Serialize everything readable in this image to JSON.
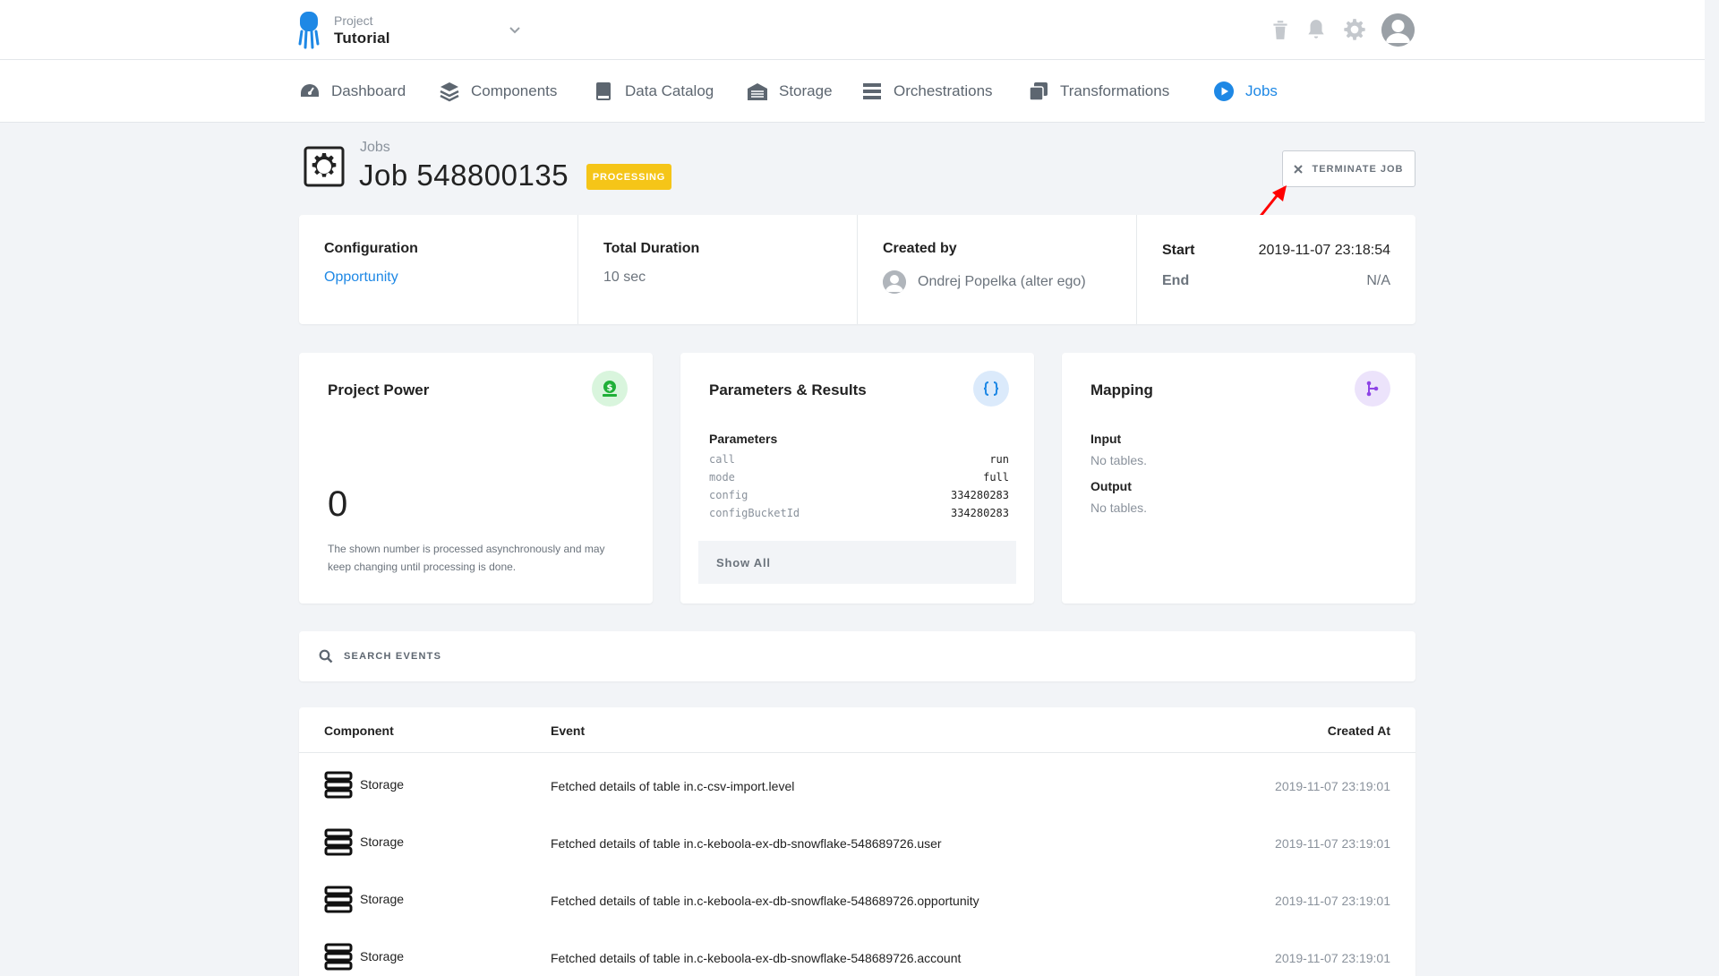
{
  "project": {
    "label": "Project",
    "name": "Tutorial"
  },
  "nav": [
    {
      "label": "Dashboard",
      "icon": "gauge-icon"
    },
    {
      "label": "Components",
      "icon": "layers-icon"
    },
    {
      "label": "Data Catalog",
      "icon": "book-icon"
    },
    {
      "label": "Storage",
      "icon": "warehouse-icon"
    },
    {
      "label": "Orchestrations",
      "icon": "bars-icon"
    },
    {
      "label": "Transformations",
      "icon": "copy-icon"
    },
    {
      "label": "Jobs",
      "icon": "play-circle-icon"
    }
  ],
  "header": {
    "breadcrumb": "Jobs",
    "title": "Job 548800135",
    "status": "PROCESSING",
    "status_color": "#f5c518",
    "terminate_label": "TERMINATE JOB"
  },
  "summary": {
    "configuration_label": "Configuration",
    "configuration_value": "Opportunity",
    "duration_label": "Total Duration",
    "duration_value": "10 sec",
    "created_by_label": "Created by",
    "created_by_value": "Ondrej Popelka (alter ego)",
    "start_label": "Start",
    "start_value": "2019-11-07 23:18:54",
    "end_label": "End",
    "end_value": "N/A"
  },
  "power": {
    "title": "Project Power",
    "value": "0",
    "note": "The shown number is processed asynchronously and may keep changing until processing is done."
  },
  "params": {
    "title": "Parameters & Results",
    "subtitle": "Parameters",
    "rows": [
      {
        "key": "call",
        "value": "run"
      },
      {
        "key": "mode",
        "value": "full"
      },
      {
        "key": "config",
        "value": "334280283"
      },
      {
        "key": "configBucketId",
        "value": "334280283"
      }
    ],
    "show_all": "Show All"
  },
  "mapping": {
    "title": "Mapping",
    "input_label": "Input",
    "input_value": "No tables.",
    "output_label": "Output",
    "output_value": "No tables."
  },
  "search": {
    "placeholder": "SEARCH EVENTS"
  },
  "events": {
    "headers": {
      "component": "Component",
      "event": "Event",
      "created_at": "Created At"
    },
    "rows": [
      {
        "component": "Storage",
        "event": "Fetched details of table in.c-csv-import.level",
        "created_at": "2019-11-07 23:19:01"
      },
      {
        "component": "Storage",
        "event": "Fetched details of table in.c-keboola-ex-db-snowflake-548689726.user",
        "created_at": "2019-11-07 23:19:01"
      },
      {
        "component": "Storage",
        "event": "Fetched details of table in.c-keboola-ex-db-snowflake-548689726.opportunity",
        "created_at": "2019-11-07 23:19:01"
      },
      {
        "component": "Storage",
        "event": "Fetched details of table in.c-keboola-ex-db-snowflake-548689726.account",
        "created_at": "2019-11-07 23:19:01"
      }
    ]
  },
  "colors": {
    "accent": "#1e88e5",
    "power_icon_bg": "#d9f5dd",
    "params_icon_bg": "#dbeafb",
    "mapping_icon_bg": "#ece3fb",
    "annotation_arrow": "#ff0000"
  }
}
